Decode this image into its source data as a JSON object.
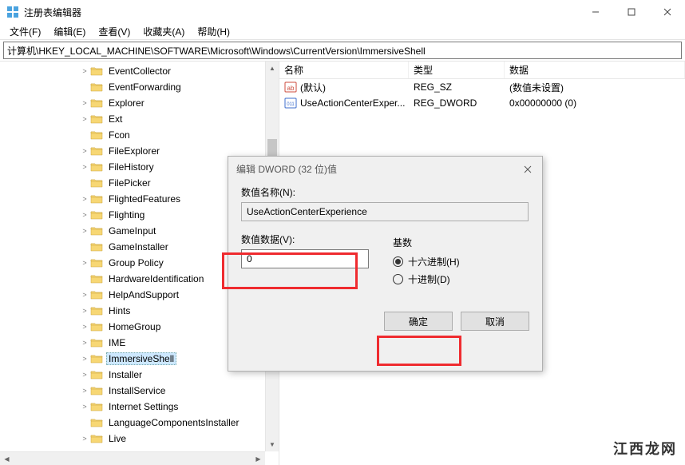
{
  "window": {
    "title": "注册表编辑器"
  },
  "menu": {
    "file": "文件(F)",
    "edit": "编辑(E)",
    "view": "查看(V)",
    "favorites": "收藏夹(A)",
    "help": "帮助(H)"
  },
  "address": "计算机\\HKEY_LOCAL_MACHINE\\SOFTWARE\\Microsoft\\Windows\\CurrentVersion\\ImmersiveShell",
  "tree": {
    "items": [
      {
        "label": "EventCollector",
        "exp": ">"
      },
      {
        "label": "EventForwarding",
        "exp": ""
      },
      {
        "label": "Explorer",
        "exp": ">"
      },
      {
        "label": "Ext",
        "exp": ">"
      },
      {
        "label": "Fcon",
        "exp": ""
      },
      {
        "label": "FileExplorer",
        "exp": ">"
      },
      {
        "label": "FileHistory",
        "exp": ">"
      },
      {
        "label": "FilePicker",
        "exp": ""
      },
      {
        "label": "FlightedFeatures",
        "exp": ">"
      },
      {
        "label": "Flighting",
        "exp": ">"
      },
      {
        "label": "GameInput",
        "exp": ">"
      },
      {
        "label": "GameInstaller",
        "exp": ""
      },
      {
        "label": "Group Policy",
        "exp": ">"
      },
      {
        "label": "HardwareIdentification",
        "exp": ""
      },
      {
        "label": "HelpAndSupport",
        "exp": ">"
      },
      {
        "label": "Hints",
        "exp": ">"
      },
      {
        "label": "HomeGroup",
        "exp": ">"
      },
      {
        "label": "IME",
        "exp": ">"
      },
      {
        "label": "ImmersiveShell",
        "exp": ">",
        "selected": true
      },
      {
        "label": "Installer",
        "exp": ">"
      },
      {
        "label": "InstallService",
        "exp": ">"
      },
      {
        "label": "Internet Settings",
        "exp": ">"
      },
      {
        "label": "LanguageComponentsInstaller",
        "exp": ""
      },
      {
        "label": "Live",
        "exp": ">"
      }
    ]
  },
  "columns": {
    "name": "名称",
    "type": "类型",
    "data": "数据"
  },
  "values": [
    {
      "icon": "sz",
      "name": "(默认)",
      "type": "REG_SZ",
      "data": "(数值未设置)"
    },
    {
      "icon": "dw",
      "name": "UseActionCenterExper...",
      "type": "REG_DWORD",
      "data": "0x00000000 (0)"
    }
  ],
  "dialog": {
    "title": "编辑 DWORD (32 位)值",
    "name_label": "数值名称(N):",
    "name_value": "UseActionCenterExperience",
    "data_label": "数值数据(V):",
    "data_value": "0",
    "base_label": "基数",
    "hex_label": "十六进制(H)",
    "dec_label": "十进制(D)",
    "ok": "确定",
    "cancel": "取消"
  },
  "watermark": "江西龙网"
}
